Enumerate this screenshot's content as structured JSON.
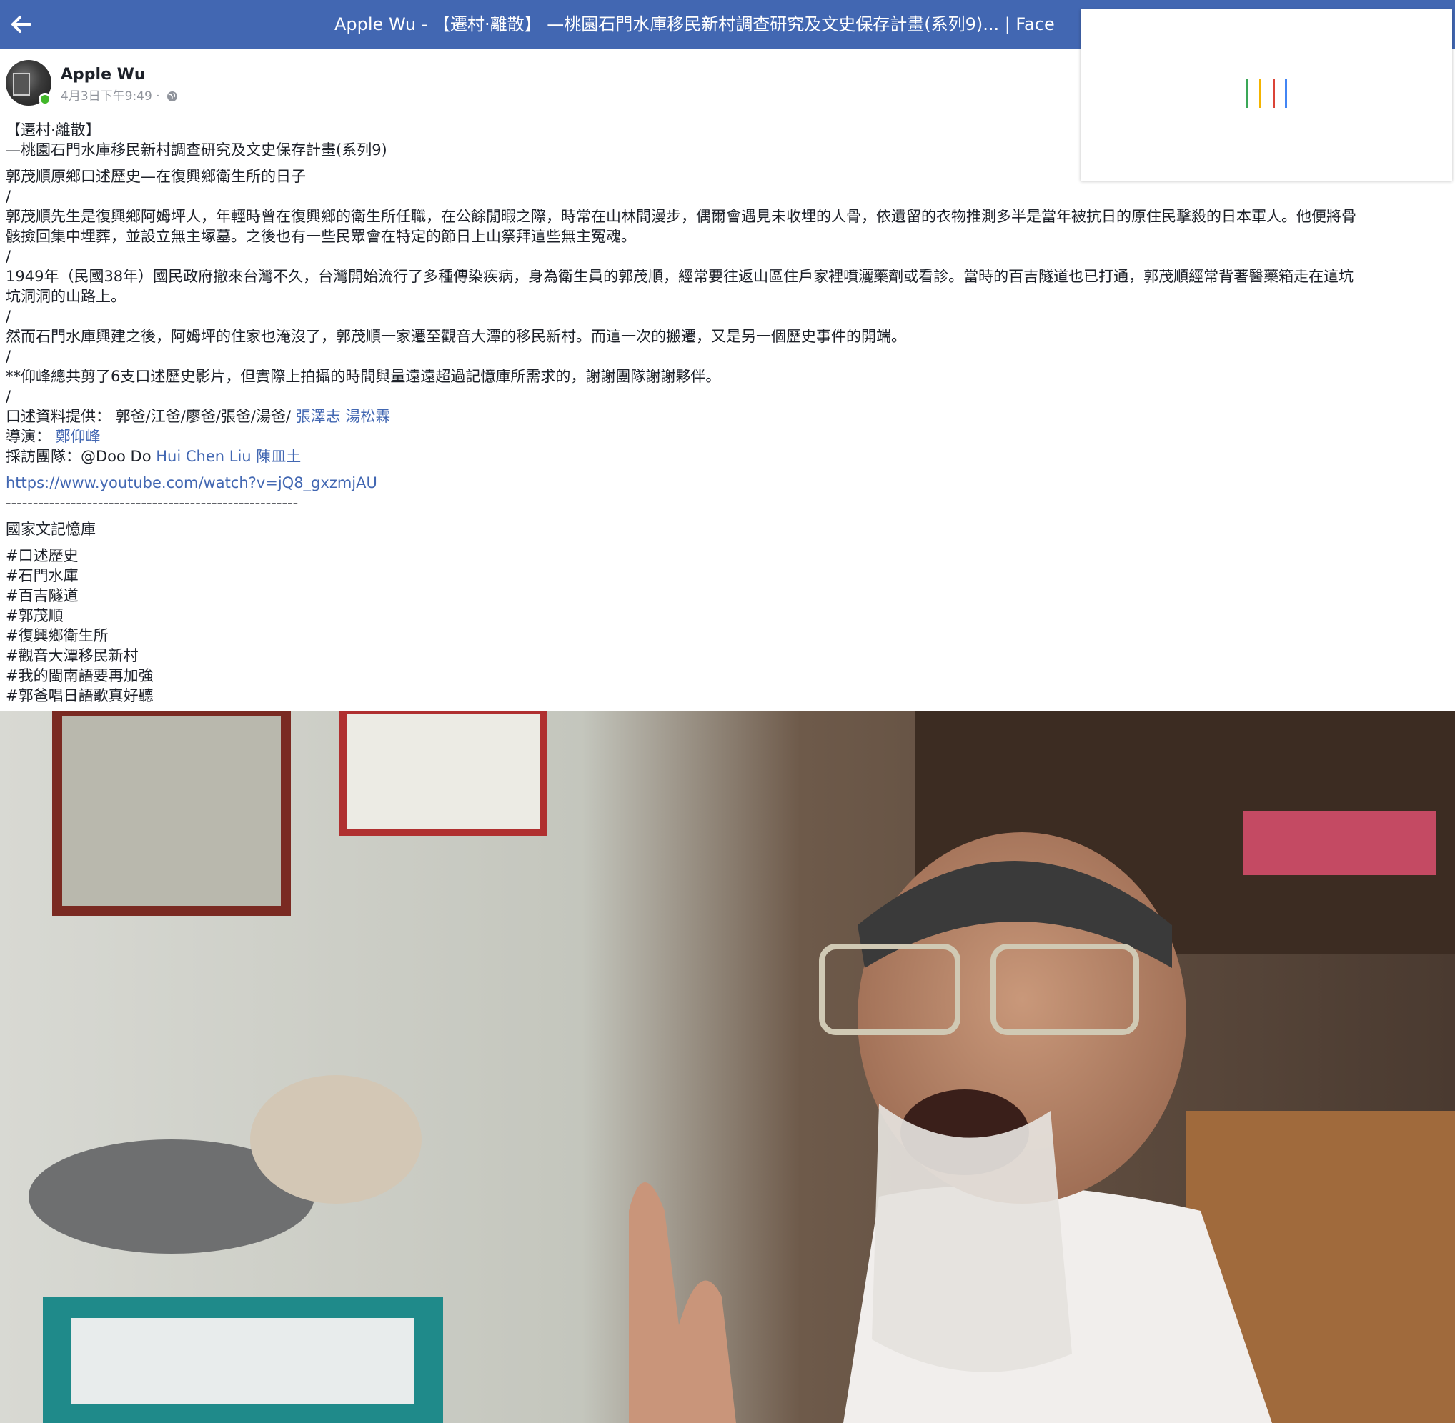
{
  "header": {
    "title": "Apple Wu - 【遷村·離散】 —桃園石門水庫移民新村調查研究及文史保存計畫(系列9)... | Face"
  },
  "loader": {
    "bar_colors": [
      "#3aa757",
      "#f4b400",
      "#db4437",
      "#4285f4"
    ]
  },
  "post": {
    "author": "Apple Wu",
    "timestamp": "4月3日下午9:49 ·",
    "privacy_icon": "globe-icon",
    "online": true,
    "lines": [
      {
        "text": "【遷村·離散】",
        "gap": false
      },
      {
        "text": "—桃園石門水庫移民新村調查研究及文史保存計畫(系列9)",
        "gap": false
      },
      {
        "text": "郭茂順原鄉口述歷史—在復興鄉衛生所的日子",
        "gap": true
      },
      {
        "text": "/",
        "gap": false
      },
      {
        "text": "郭茂順先生是復興鄉阿姆坪人，年輕時曾在復興鄉的衛生所任職，在公餘閒暇之際，時常在山林間漫步，偶爾會遇見未收埋的人骨，依遺留的衣物推測多半是當年被抗日的原住民擊殺的日本軍人。他便將骨",
        "gap": false
      },
      {
        "text": "骸撿回集中埋葬，並設立無主塚墓。之後也有一些民眾會在特定的節日上山祭拜這些無主冤魂。",
        "gap": false
      },
      {
        "text": "/",
        "gap": false
      },
      {
        "text": "1949年（民國38年）國民政府撤來台灣不久，台灣開始流行了多種傳染疾病，身為衛生員的郭茂順，經常要往返山區住戶家裡噴灑藥劑或看診。當時的百吉隧道也已打通，郭茂順經常背著醫藥箱走在這坑",
        "gap": false
      },
      {
        "text": "坑洞洞的山路上。",
        "gap": false
      },
      {
        "text": "/",
        "gap": false
      },
      {
        "text": "然而石門水庫興建之後，阿姆坪的住家也淹沒了，郭茂順一家遷至觀音大潭的移民新村。而這一次的搬遷，又是另一個歷史事件的開端。",
        "gap": false
      },
      {
        "text": "/",
        "gap": false
      },
      {
        "text": "**仰峰總共剪了6支口述歷史影片，但實際上拍攝的時間與量遠遠超過記憶庫所需求的，謝謝團隊謝謝夥伴。",
        "gap": false
      },
      {
        "text": "/",
        "gap": false
      }
    ],
    "credits": [
      {
        "label": "口述資料提供： 郭爸/江爸/廖爸/張爸/湯爸/ ",
        "links": [
          "張澤志",
          "湯松霖"
        ]
      },
      {
        "label": "導演： ",
        "links": [
          "鄭仰峰"
        ]
      },
      {
        "label": "採訪團隊：@Doo Do ",
        "links": [
          "Hui Chen Liu",
          "陳皿土"
        ]
      }
    ],
    "url": "https://www.youtube.com/watch?v=jQ8_gxzmjAU",
    "divider": "------------------------------------------------------",
    "archive": "國家文記憶庫",
    "hashtags": [
      "#口述歷史",
      "#石門水庫",
      "#百吉隧道",
      "#郭茂順",
      "#復興鄉衛生所",
      "#觀音大潭移民新村",
      "#我的閩南語要再加強",
      "#郭爸唱日語歌真好聽"
    ]
  },
  "colors": {
    "topbar": "#4267b2",
    "link": "#4267b2",
    "online": "#42b72a"
  }
}
